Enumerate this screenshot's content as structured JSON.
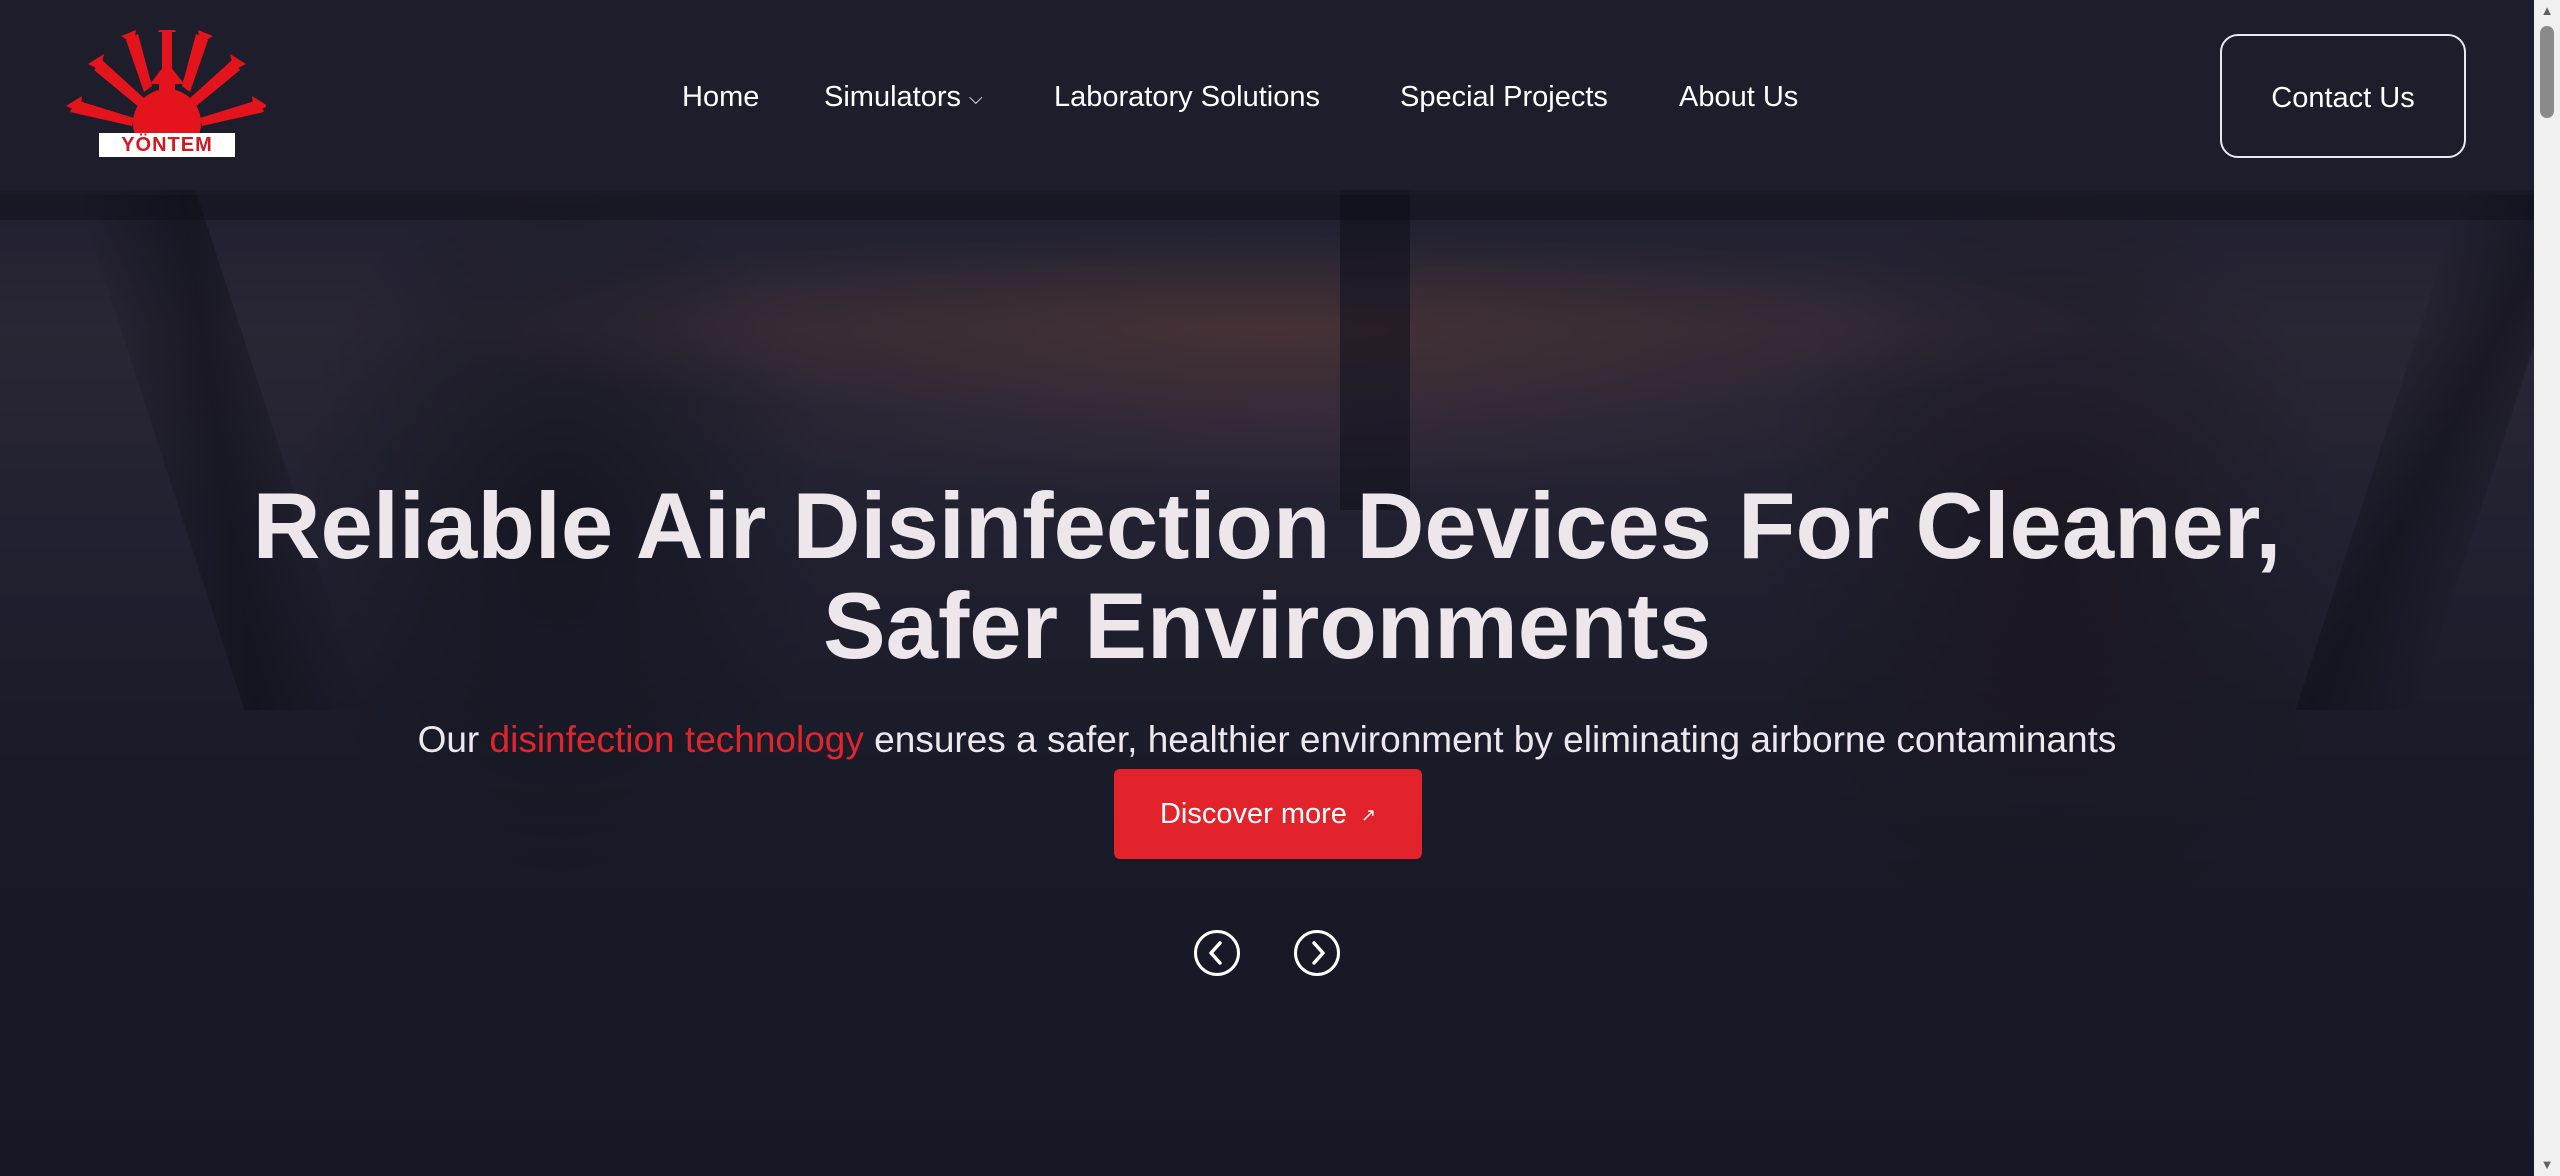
{
  "header": {
    "logo_text": "YÖNTEM",
    "nav": [
      {
        "label": "Home",
        "has_dropdown": false
      },
      {
        "label": "Simulators",
        "has_dropdown": true
      },
      {
        "label": "Laboratory Solutions",
        "has_dropdown": false
      },
      {
        "label": "Special Projects",
        "has_dropdown": false
      },
      {
        "label": "About Us",
        "has_dropdown": false
      }
    ],
    "contact_label": "Contact Us"
  },
  "hero": {
    "title_line1": "Reliable Air Disinfection Devices For Cleaner,",
    "title_line2": "Safer Environments",
    "subtitle_pre": "Our ",
    "subtitle_highlight": "disinfection technology",
    "subtitle_post": " ensures a safer, healthier environment by eliminating airborne contaminants",
    "cta_label": "Discover more"
  },
  "icons": {
    "prev": "chevron-left-circle-icon",
    "next": "chevron-right-circle-icon",
    "dropdown": "chevron-down-icon",
    "cta": "arrow-up-right-icon"
  },
  "colors": {
    "accent": "#e2232b",
    "highlight_text": "#e0252d",
    "overlay": "#1a1b2a"
  }
}
